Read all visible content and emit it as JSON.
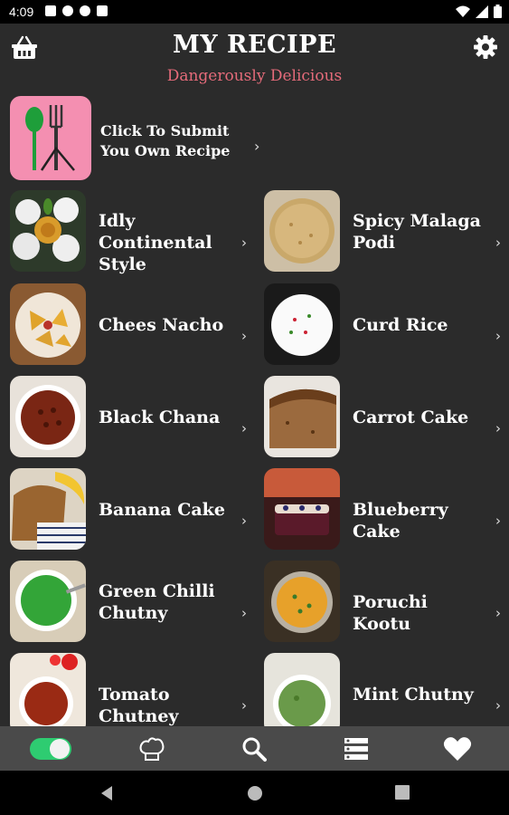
{
  "status": {
    "time": "4:09"
  },
  "header": {
    "title": "MY RECIPE",
    "subtitle": "Dangerously Delicious"
  },
  "submit": {
    "label": "Click To Submit You Own Recipe"
  },
  "recipes": [
    {
      "label": "Idly  Continental Style"
    },
    {
      "label": "Spicy Malaga Podi"
    },
    {
      "label": " Chees Nacho"
    },
    {
      "label": "Curd Rice"
    },
    {
      "label": "Black Chana"
    },
    {
      "label": "Carrot Cake"
    },
    {
      "label": "Banana Cake"
    },
    {
      "label": "Blueberry Cake"
    },
    {
      "label": "Green Chilli Chutny"
    },
    {
      "label": "Poruchi Kootu"
    },
    {
      "label": "Tomato Chutney"
    },
    {
      "label": "Mint Chutny"
    }
  ],
  "chevron": "›",
  "colors": {
    "accent": "#e56b7a",
    "toggle": "#2ecc71",
    "background": "#2b2b2b",
    "nav": "#4a4a4a"
  },
  "icons": {
    "top_left": "basket-icon",
    "top_right": "gear-icon",
    "nav": [
      "toggle-icon",
      "chef-hat-icon",
      "search-icon",
      "list-icon",
      "heart-icon"
    ]
  }
}
